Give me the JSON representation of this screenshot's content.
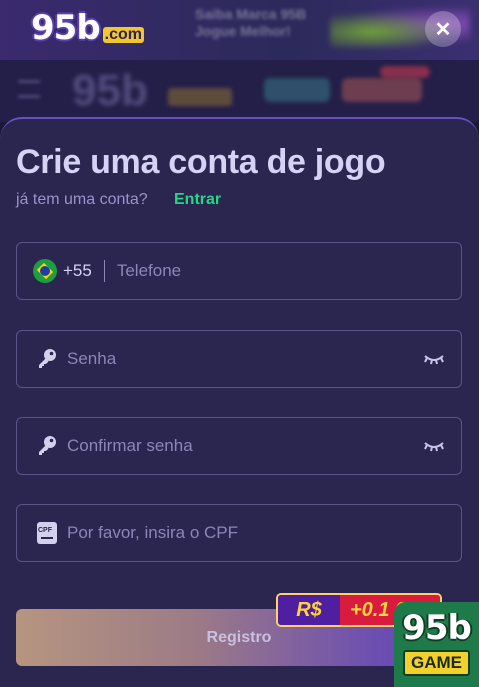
{
  "background": {
    "banner_text": "Saiba Marca 95B Jogue Melhor!",
    "logo_text": "95b"
  },
  "header": {
    "brand_main": "95b",
    "brand_domain": ".com",
    "close_label": "✕"
  },
  "form": {
    "title": "Crie uma conta de jogo",
    "subtitle": "já tem uma conta?",
    "login_link": "Entrar",
    "phone": {
      "country_code": "+55",
      "placeholder": "Telefone"
    },
    "password": {
      "placeholder": "Senha"
    },
    "confirm_password": {
      "placeholder": "Confirmar senha"
    },
    "cpf": {
      "placeholder": "Por favor, insira o CPF",
      "icon_text": "CPF"
    },
    "register_label": "Registro"
  },
  "bonus": {
    "currency": "R$",
    "value": "+0.1 00"
  },
  "game_badge": {
    "brand": "95b",
    "label": "GAME"
  },
  "colors": {
    "accent_green": "#27d685",
    "sheet_bg": "#2b2650",
    "title": "#d6d2f5"
  }
}
